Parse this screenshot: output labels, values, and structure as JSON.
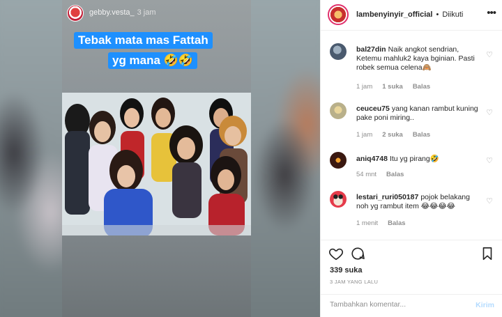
{
  "story": {
    "username": "gebby.vesta_",
    "time": "3 jam",
    "caption_line1": "Tebak mata mas Fattah",
    "caption_line2": "yg mana 🤣🤣"
  },
  "header": {
    "username": "lambenyinyir_official",
    "separator": "•",
    "follow_status": "Diikuti",
    "more_icon": "more-horizontal-icon"
  },
  "comments": [
    {
      "username": "bal27din",
      "text": "Naik angkot sendrian, Ketemu mahluk2 kaya bginian. Pasti robek semua celena🙈",
      "time": "1 jam",
      "likes": "1 suka",
      "reply": "Balas"
    },
    {
      "username": "ceuceu75",
      "text": "yang kanan rambut kuning pake poni miring..",
      "time": "1 jam",
      "likes": "2 suka",
      "reply": "Balas"
    },
    {
      "username": "aniq4748",
      "text": "Itu yg pirang🤣",
      "time": "54 mnt",
      "likes": "",
      "reply": "Balas"
    },
    {
      "username": "lestari_ruri050187",
      "text": "pojok belakang noh yg rambut item 😂😂😂😂",
      "time": "1 menit",
      "likes": "",
      "reply": "Balas"
    }
  ],
  "actions": {
    "likes": "339 suka",
    "time_ago": "3 JAM YANG LALU"
  },
  "comment_box": {
    "placeholder": "Tambahkan komentar...",
    "post_label": "Kirim"
  },
  "colors": {
    "caption_bg": "#1e90ff",
    "post_button": "#b3dbff",
    "muted_text": "#8e8e8e"
  }
}
